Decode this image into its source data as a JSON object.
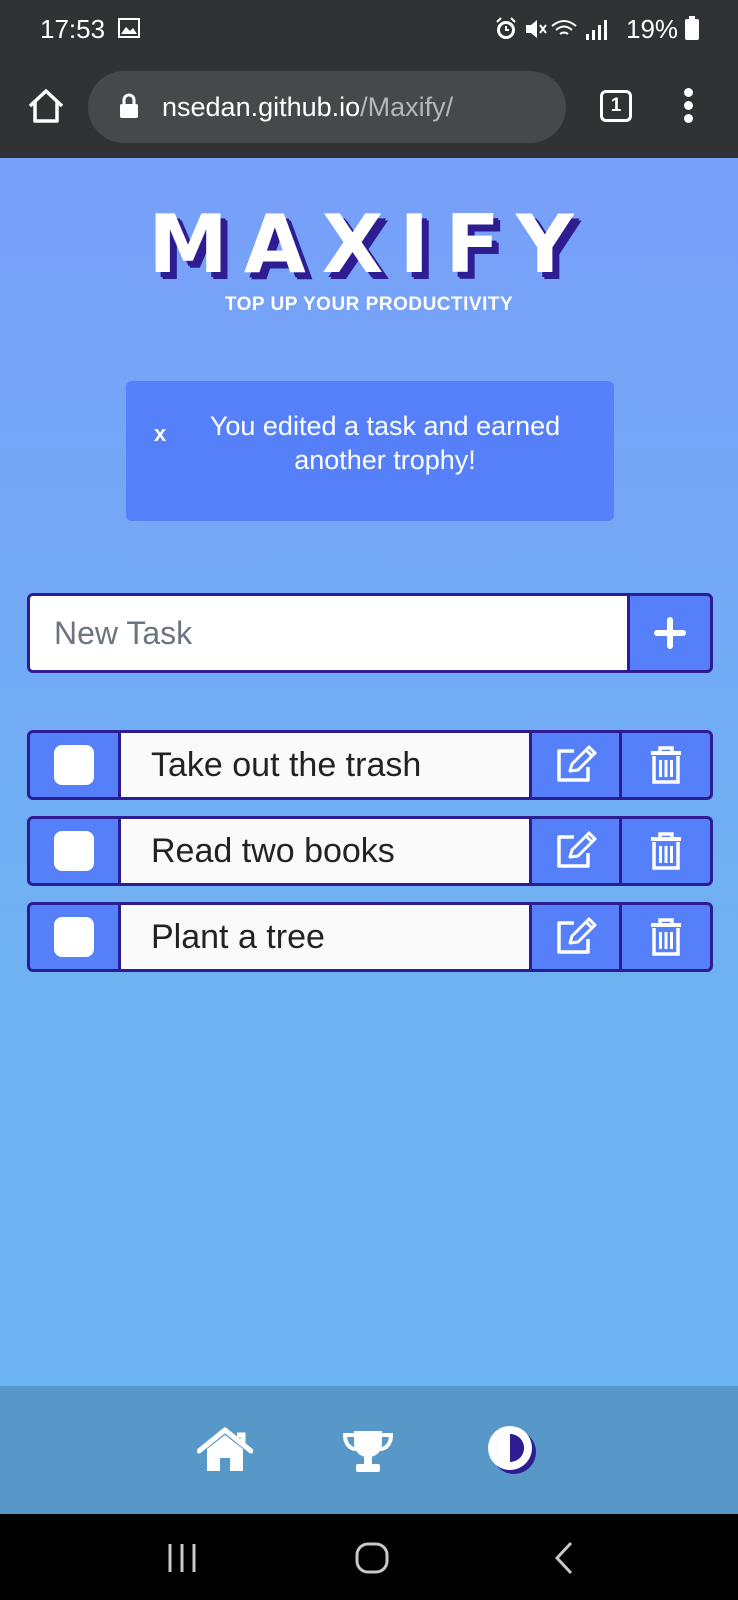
{
  "status_bar": {
    "time": "17:53",
    "battery": "19%",
    "icons": [
      "image-icon",
      "alarm-icon",
      "mute-icon",
      "wifi-icon",
      "signal-icon",
      "battery-icon"
    ]
  },
  "browser": {
    "url_domain": "nsedan.github.io",
    "url_path": "/Maxify/",
    "tab_count": "1"
  },
  "app": {
    "logo": "MAXIFY",
    "tagline": "TOP UP YOUR PRODUCTIVITY",
    "alert": {
      "close": "x",
      "message": "You edited a task and earned another trophy!"
    },
    "new_task": {
      "placeholder": "New Task",
      "value": ""
    },
    "tasks": [
      {
        "text": "Take out the trash",
        "done": false
      },
      {
        "text": "Read two books",
        "done": false
      },
      {
        "text": "Plant a tree",
        "done": false
      }
    ]
  },
  "bottom_nav": [
    "home-icon",
    "trophy-icon",
    "theme-toggle-icon"
  ],
  "colors": {
    "background_top": "#789ff9",
    "background_bottom": "#6db5f2",
    "accent": "#5680fa",
    "border": "#2e1d92",
    "nav": "#5798c8"
  }
}
